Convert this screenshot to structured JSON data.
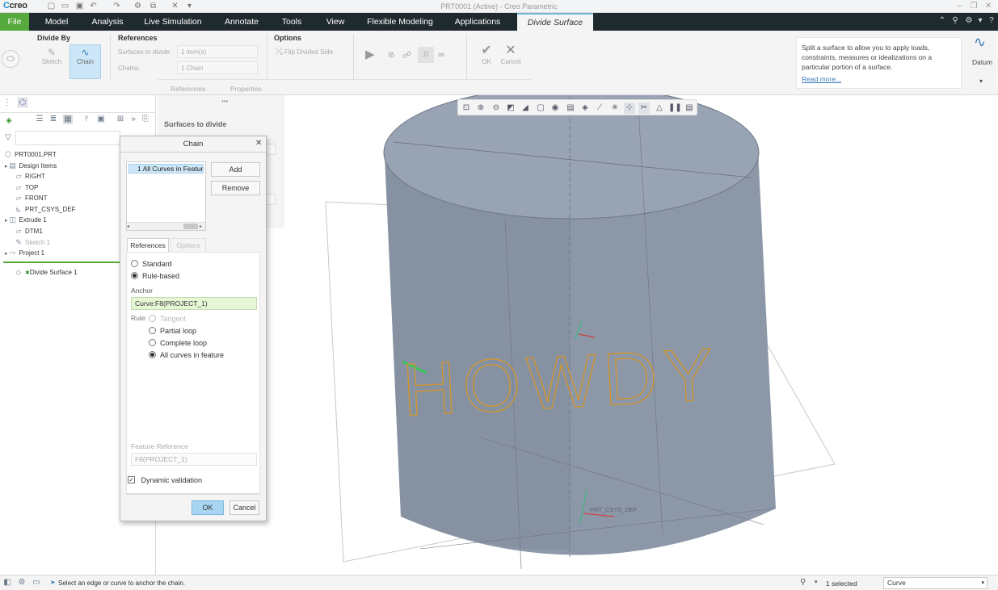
{
  "titlebar": {
    "logo": "creo",
    "window_title": "PRT0001 (Active) - Creo Parametric"
  },
  "menubar": {
    "items": [
      "File",
      "Model",
      "Analysis",
      "Live Simulation",
      "Annotate",
      "Tools",
      "View",
      "Flexible Modeling",
      "Applications"
    ],
    "active_tab": "Divide Surface"
  },
  "ribbon": {
    "divide_by": {
      "title": "Divide By",
      "sketch": "Sketch",
      "chain": "Chain"
    },
    "references": {
      "title": "References",
      "surfaces_label": "Surfaces to divide:",
      "surfaces_value": "1 item(s)",
      "chains_label": "Chains:",
      "chains_value": "1 Chain"
    },
    "options": {
      "title": "Options",
      "flip": "Flip Divided Side"
    },
    "ok": "OK",
    "cancel": "Cancel",
    "tab_references": "References",
    "tab_properties": "Properties",
    "datum": "Datum"
  },
  "help": {
    "text": "Split a surface to allow you to apply loads, constraints, measures or idealizations on a particular portion of a surface.",
    "link": "Read more..."
  },
  "model_tree": {
    "root": "PRT0001.PRT",
    "items": [
      "Design Items",
      "RIGHT",
      "TOP",
      "FRONT",
      "PRT_CSYS_DEF",
      "Extrude 1",
      "DTM1",
      "Sketch 1",
      "Project 1"
    ],
    "insert_item": "Divide Surface 1"
  },
  "ref_panel": {
    "title": "Surfaces to divide"
  },
  "chain_dialog": {
    "title": "Chain",
    "list_item": "1 All Curves in Feature",
    "add": "Add",
    "remove": "Remove",
    "tab_references": "References",
    "tab_options": "Options",
    "standard": "Standard",
    "rule_based": "Rule-based",
    "anchor_label": "Anchor",
    "anchor_value": "Curve:F8(PROJECT_1)",
    "rule_label": "Rule:",
    "rule_tangent": "Tangent",
    "rule_partial": "Partial loop",
    "rule_complete": "Complete loop",
    "rule_all": "All curves in feature",
    "feature_ref_label": "Feature Reference",
    "feature_ref_value": "F8(PROJECT_1)",
    "dynamic_validation": "Dynamic validation",
    "ok": "OK",
    "cancel": "Cancel"
  },
  "viewport": {
    "text_on_surface": "HOWDY",
    "csys_label": "PRT_CSYS_DEF"
  },
  "statusbar": {
    "message": "Select an edge or curve to anchor the chain.",
    "selected": "1 selected",
    "filter": "Curve"
  }
}
